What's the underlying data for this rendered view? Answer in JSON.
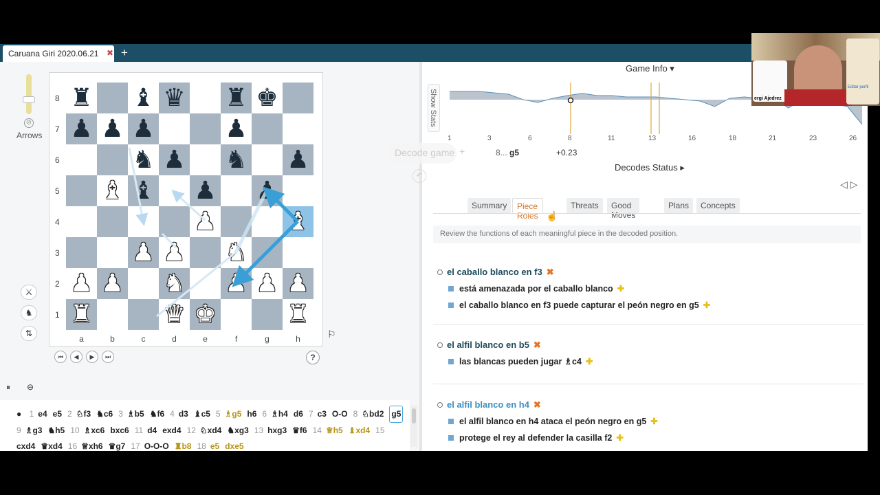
{
  "tab": {
    "title": "Caruana Giri 2020.06.21",
    "close": "✖",
    "add": "+"
  },
  "left": {
    "arrows_label": "Arrows",
    "ranks": [
      "8",
      "7",
      "6",
      "5",
      "4",
      "3",
      "2",
      "1"
    ],
    "files": [
      "a",
      "b",
      "c",
      "d",
      "e",
      "f",
      "g",
      "h"
    ],
    "help": "?"
  },
  "board": {
    "pieces": [
      {
        "sq": "a8",
        "t": "♜",
        "c": "b"
      },
      {
        "sq": "c8",
        "t": "♝",
        "c": "b"
      },
      {
        "sq": "d8",
        "t": "♛",
        "c": "b"
      },
      {
        "sq": "f8",
        "t": "♜",
        "c": "b"
      },
      {
        "sq": "g8",
        "t": "♚",
        "c": "b"
      },
      {
        "sq": "a7",
        "t": "♟",
        "c": "b"
      },
      {
        "sq": "b7",
        "t": "♟",
        "c": "b"
      },
      {
        "sq": "c7",
        "t": "♟",
        "c": "b"
      },
      {
        "sq": "f7",
        "t": "♟",
        "c": "b"
      },
      {
        "sq": "c6",
        "t": "♞",
        "c": "b"
      },
      {
        "sq": "d6",
        "t": "♟",
        "c": "b"
      },
      {
        "sq": "f6",
        "t": "♞",
        "c": "b"
      },
      {
        "sq": "h6",
        "t": "♟",
        "c": "b"
      },
      {
        "sq": "b5",
        "t": "♝",
        "c": "w"
      },
      {
        "sq": "c5",
        "t": "♝",
        "c": "b"
      },
      {
        "sq": "e5",
        "t": "♟",
        "c": "b"
      },
      {
        "sq": "g5",
        "t": "♟",
        "c": "b"
      },
      {
        "sq": "e4",
        "t": "♟",
        "c": "w"
      },
      {
        "sq": "h4",
        "t": "♝",
        "c": "w"
      },
      {
        "sq": "c3",
        "t": "♟",
        "c": "w"
      },
      {
        "sq": "d3",
        "t": "♟",
        "c": "w"
      },
      {
        "sq": "f3",
        "t": "♞",
        "c": "w"
      },
      {
        "sq": "a2",
        "t": "♟",
        "c": "w"
      },
      {
        "sq": "b2",
        "t": "♟",
        "c": "w"
      },
      {
        "sq": "d2",
        "t": "♞",
        "c": "w"
      },
      {
        "sq": "f2",
        "t": "♟",
        "c": "w"
      },
      {
        "sq": "g2",
        "t": "♟",
        "c": "w"
      },
      {
        "sq": "h2",
        "t": "♟",
        "c": "w"
      },
      {
        "sq": "a1",
        "t": "♜",
        "c": "w"
      },
      {
        "sq": "d1",
        "t": "♛",
        "c": "w"
      },
      {
        "sq": "e1",
        "t": "♚",
        "c": "w"
      },
      {
        "sq": "h1",
        "t": "♜",
        "c": "w"
      }
    ],
    "highlight": [
      "h4"
    ]
  },
  "moves": [
    {
      "n": "1",
      "m": "e4"
    },
    {
      "m": "e5"
    },
    {
      "n": "2",
      "m": "♘f3"
    },
    {
      "m": "♞c6"
    },
    {
      "n": "3",
      "m": "♗b5"
    },
    {
      "m": "♞f6"
    },
    {
      "n": "4",
      "m": "d3"
    },
    {
      "m": "♝c5"
    },
    {
      "n": "5",
      "m": "♗g5",
      "gold": true
    },
    {
      "m": "h6"
    },
    {
      "n": "6",
      "m": "♗h4"
    },
    {
      "m": "d6"
    },
    {
      "n": "7",
      "m": "c3"
    },
    {
      "m": "O-O"
    },
    {
      "n": "8",
      "m": "♘bd2"
    },
    {
      "m": "g5",
      "sel": true
    },
    {
      "n": "9",
      "m": "♗g3"
    },
    {
      "m": "♞h5"
    },
    {
      "n": "10",
      "m": "♗xc6"
    },
    {
      "m": "bxc6"
    },
    {
      "n": "11",
      "m": "d4"
    },
    {
      "m": "exd4"
    },
    {
      "n": "12",
      "m": "♘xd4"
    },
    {
      "m": "♞xg3"
    },
    {
      "n": "13",
      "m": "hxg3"
    },
    {
      "m": "♛f6"
    },
    {
      "n": "14",
      "m": "♕h5",
      "gold": true
    },
    {
      "m": "♝xd4",
      "gold": true
    },
    {
      "n": "15",
      "m": "cxd4"
    },
    {
      "m": "♛xd4"
    },
    {
      "n": "16",
      "m": "♕xh6"
    },
    {
      "m": "♛g7"
    },
    {
      "n": "17",
      "m": "O-O-O"
    },
    {
      "m": "♜b8",
      "gold": true
    },
    {
      "n": "18",
      "m": "e5",
      "gold": true
    },
    {
      "m": "dxe5",
      "gold": true
    }
  ],
  "right": {
    "game_info": "Game Info ▾",
    "show_stats": "Show Stats",
    "graph_ticks": [
      "1",
      "3",
      "6",
      "8",
      "11",
      "13",
      "16",
      "18",
      "21",
      "23",
      "26"
    ],
    "graph_values": [
      0.3,
      0.3,
      0.3,
      0.25,
      0.2,
      0.0,
      -0.1,
      0.05,
      0.15,
      0.23,
      0.15,
      0.15,
      0.1,
      0.1,
      0.1,
      0.05,
      0.0,
      -0.05,
      -0.25,
      0.05,
      0.1,
      0.05,
      0.05,
      -0.3,
      0.0,
      -0.1,
      -0.15,
      -0.25,
      -0.9
    ],
    "stat_move_num": "8...",
    "stat_move": "g5",
    "stat_eval": "+0.23",
    "decodes_status": "Decodes Status ▸",
    "decode_game": "Decode game",
    "tabs": [
      "Summary",
      "Piece Roles",
      "Threats",
      "Good Moves",
      "Plans",
      "Concepts"
    ],
    "active_tab": 1,
    "hint": "Review the functions of each meaningful piece in the decoded position.",
    "roles": [
      {
        "head": "el caballo blanco en f3",
        "color": "#1d4a5e",
        "items": [
          "está amenazada por el caballo blanco",
          "el caballo blanco en f3 puede capturar el peón negro en g5"
        ]
      },
      {
        "head": "el alfil blanco en b5",
        "color": "#1d4a5e",
        "items": [
          "las blancas pueden jugar ♗c4"
        ]
      },
      {
        "head": "el alfil blanco en h4",
        "color": "#3a8fc4",
        "items": [
          "el alfil blanco en h4 ataca el peón negro en g5",
          "protege el rey al defender la casilla f2"
        ]
      }
    ],
    "marks": {
      "x": "✖",
      "plus": "✚"
    }
  },
  "webcam": {
    "caption": "ergi Ajedrez",
    "right_caption": "Editar perfil"
  },
  "colors": {
    "tabbar": "#1c4f66",
    "accent": "#d4762a",
    "arrow": "#3a9fd6",
    "dark_square": "#a7b4c1"
  }
}
